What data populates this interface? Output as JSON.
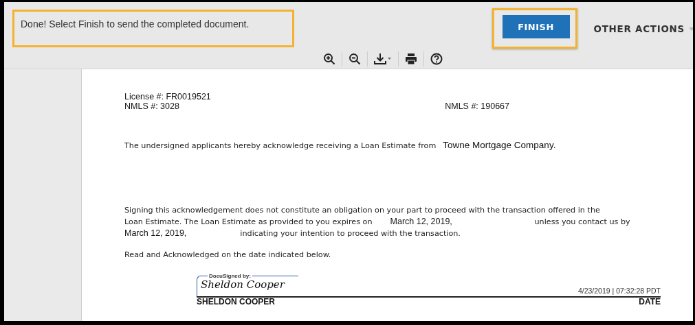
{
  "header": {
    "message": "Done! Select Finish to send the completed document.",
    "finish_button": "FINISH",
    "other_actions": "OTHER ACTIONS"
  },
  "toolbar": [
    {
      "kind": "zoom-in"
    },
    {
      "kind": "zoom-out"
    },
    {
      "kind": "download"
    },
    {
      "kind": "print"
    },
    {
      "kind": "help"
    }
  ],
  "document": {
    "license": "License #:  FR0019521",
    "nmls_left": "NMLS #:  3028",
    "nmls_right": "NMLS #:  190667",
    "acknowledge_text": "The undersigned applicants hereby acknowledge receiving a Loan Estimate from",
    "lender": "Towne Mortgage Company.",
    "paragraph_line_1": "Signing this acknowledgement does not constitute an obligation on your part to proceed with the transaction offered in the",
    "paragraph_line_2_start": "Loan Estimate. The Loan Estimate as provided to you expires on",
    "expiry_date": "March 12, 2019,",
    "paragraph_line_2_end": "unless you contact us by",
    "contact_date": "March 12, 2019,",
    "paragraph_line_3_end": "indicating your intention to proceed with the transaction.",
    "read_line": "Read and Acknowledged on the date indicated below.",
    "signature": {
      "label": "DocuSigned by:",
      "name": "Sheldon Cooper"
    },
    "signed_at": "4/23/2019 | 07:32:28 PDT",
    "signer_name": "SHELDON COOPER",
    "date_label": "DATE"
  }
}
